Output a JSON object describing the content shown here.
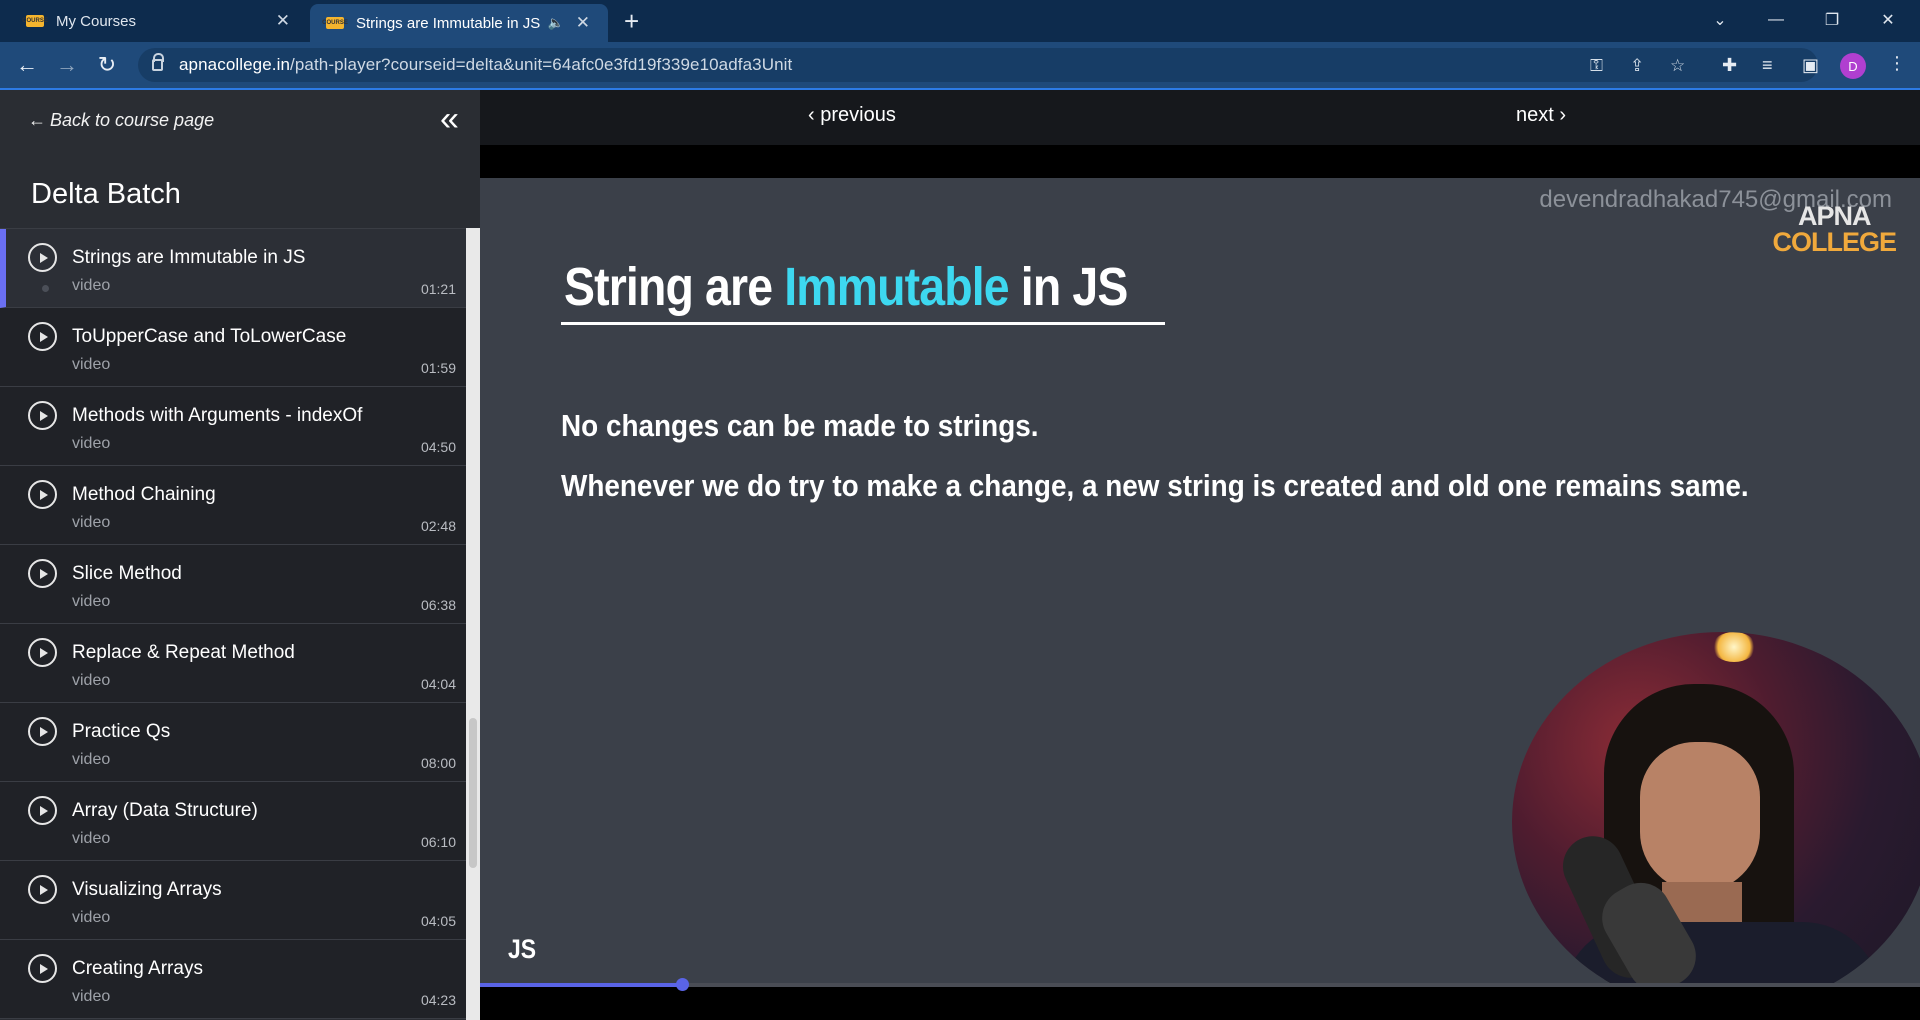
{
  "browser": {
    "tabs": [
      {
        "label": "My Courses",
        "favicon": "course-favicon"
      },
      {
        "label": "Strings are Immutable in JS",
        "favicon": "course-favicon",
        "audio": "speaker-icon"
      }
    ],
    "favicon_text": "COURSE",
    "url_host": "apnacollege.in",
    "url_path": "/path-player?courseid=delta&unit=64afc0e3fd19f339e10adfa3Unit",
    "avatar_letter": "D",
    "accent_color": "#2d7be5"
  },
  "sidebar": {
    "back_label": "Back to course page",
    "course_title": "Delta Batch",
    "items": [
      {
        "title": "Strings are Immutable in JS",
        "kind": "video",
        "duration": "01:21",
        "active": true
      },
      {
        "title": "ToUpperCase and ToLowerCase",
        "kind": "video",
        "duration": "01:59"
      },
      {
        "title": "Methods with Arguments - indexOf",
        "kind": "video",
        "duration": "04:50"
      },
      {
        "title": "Method Chaining",
        "kind": "video",
        "duration": "02:48"
      },
      {
        "title": "Slice Method",
        "kind": "video",
        "duration": "06:38"
      },
      {
        "title": "Replace & Repeat Method",
        "kind": "video",
        "duration": "04:04"
      },
      {
        "title": "Practice Qs",
        "kind": "video",
        "duration": "08:00"
      },
      {
        "title": "Array (Data Structure)",
        "kind": "video",
        "duration": "06:10"
      },
      {
        "title": "Visualizing Arrays",
        "kind": "video",
        "duration": "04:05"
      },
      {
        "title": "Creating Arrays",
        "kind": "video",
        "duration": "04:23"
      }
    ]
  },
  "player": {
    "prev_label": "previous",
    "next_label": "next",
    "watermark_email": "devendradhakad745@gmail.com",
    "brand_line1": "APNA",
    "brand_line2": "COLLEGE",
    "slide_title_pre": "String are ",
    "slide_title_highlight": "Immutable",
    "slide_title_post": " in JS",
    "line1": "No changes can be made to strings.",
    "line2": "Whenever we do try to make a change, a new string is created and old one remains same.",
    "tag": "JS",
    "progress_fraction": 0.14,
    "highlight_color": "#3dd8f0",
    "progress_color": "#5a64e6"
  }
}
